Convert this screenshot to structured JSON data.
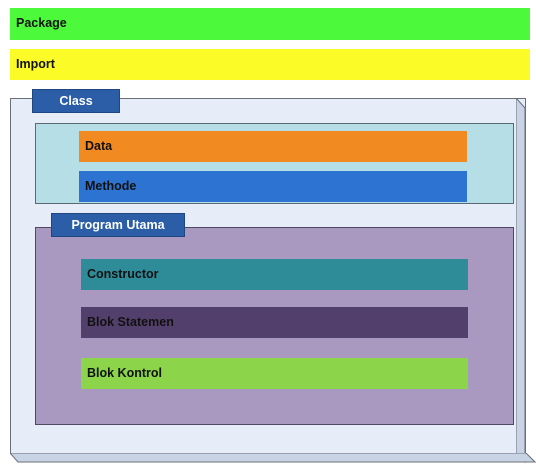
{
  "package": {
    "label": "Package"
  },
  "import": {
    "label": "Import"
  },
  "class": {
    "label": "Class",
    "members": {
      "data_label": "Data",
      "methode_label": "Methode"
    },
    "program_utama": {
      "label": "Program Utama",
      "items": [
        {
          "label": "Constructor"
        },
        {
          "label": "Blok Statemen"
        },
        {
          "label": "Blok Kontrol"
        }
      ]
    }
  },
  "colors": {
    "package": "#4dfa3b",
    "import": "#fbfb27",
    "class_background": "#e7edf8",
    "tab": "#2b5ea7",
    "members_panel": "#b6dee7",
    "data": "#f28a22",
    "methode": "#2d73d2",
    "program_panel": "#a999c1",
    "constructor": "#2e8b98",
    "blok_statemen": "#533f6b",
    "blok_kontrol": "#8cd44a"
  }
}
